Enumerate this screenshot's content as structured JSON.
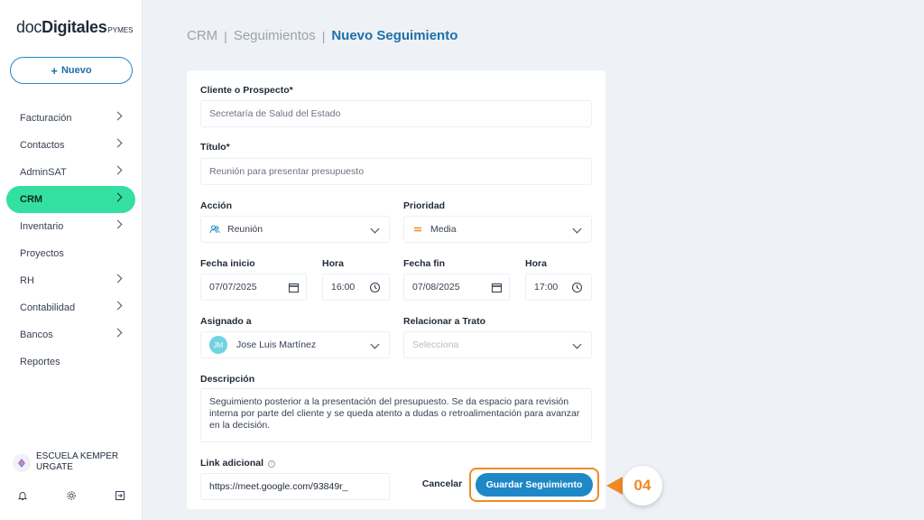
{
  "logo": {
    "doc": "doc",
    "digitales": "Digitales",
    "pymes": "PYMES"
  },
  "sidebar": {
    "new_label": "Nuevo",
    "items": [
      {
        "label": "Facturación",
        "has_chevron": true
      },
      {
        "label": "Contactos",
        "has_chevron": true
      },
      {
        "label": "AdminSAT",
        "has_chevron": true
      },
      {
        "label": "CRM",
        "has_chevron": true,
        "active": true
      },
      {
        "label": "Inventario",
        "has_chevron": true
      },
      {
        "label": "Proyectos",
        "has_chevron": false
      },
      {
        "label": "RH",
        "has_chevron": true
      },
      {
        "label": "Contabilidad",
        "has_chevron": true
      },
      {
        "label": "Bancos",
        "has_chevron": true
      },
      {
        "label": "Reportes",
        "has_chevron": false
      }
    ],
    "org_name": "ESCUELA KEMPER URGATE",
    "footer_icons": [
      "bell-icon",
      "gear-icon",
      "logout-icon"
    ]
  },
  "breadcrumb": {
    "items": [
      "CRM",
      "Seguimientos"
    ],
    "current": "Nuevo Seguimiento"
  },
  "form": {
    "cliente_label": "Cliente o Prospecto*",
    "cliente_value": "Secretaría de Salud del Estado",
    "titulo_label": "Título*",
    "titulo_value": "Reunión para presentar presupuesto",
    "accion_label": "Acción",
    "accion_value": "Reunión",
    "prioridad_label": "Prioridad",
    "prioridad_value": "Media",
    "fecha_inicio_label": "Fecha inicio",
    "fecha_inicio_value": "07/07/2025",
    "hora_inicio_label": "Hora",
    "hora_inicio_value": "16:00",
    "fecha_fin_label": "Fecha fin",
    "fecha_fin_value": "07/08/2025",
    "hora_fin_label": "Hora",
    "hora_fin_value": "17:00",
    "asignado_label": "Asignado a",
    "asignado_initials": "JM",
    "asignado_value": "Jose Luis Martínez",
    "trato_label": "Relacionar a Trato",
    "trato_placeholder": "Selecciona",
    "descripcion_label": "Descripción",
    "descripcion_value": "Seguimiento posterior a la presentación del presupuesto. Se da espacio para revisión interna por parte del cliente y se queda atento a dudas o retroalimentación para avanzar en la decisión.",
    "link_label": "Link adicional",
    "link_value": "https://meet.google.com/93849r_",
    "cancel_label": "Cancelar",
    "save_label": "Guardar Seguimiento"
  },
  "step_badge": "04",
  "colors": {
    "accent": "#1e88c7",
    "active_nav": "#34e0a1",
    "highlight": "#f08a24"
  }
}
